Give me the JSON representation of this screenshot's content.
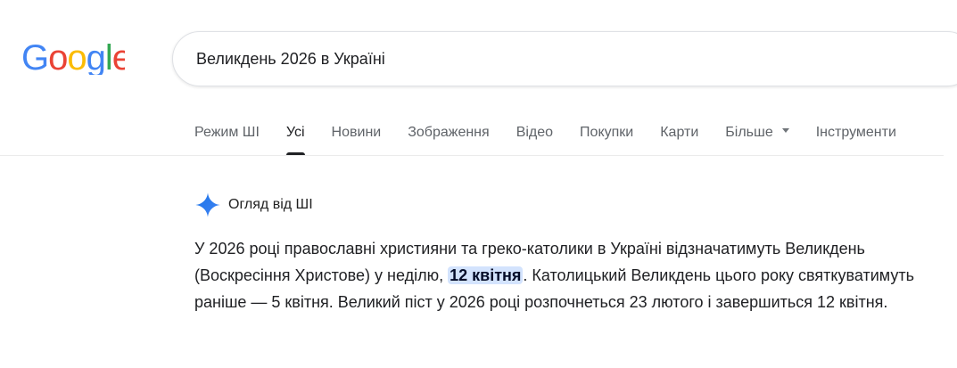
{
  "logo": {
    "text": "Google"
  },
  "search": {
    "query": "Великдень 2026 в Україні"
  },
  "tabs": [
    {
      "label": "Режим ШІ"
    },
    {
      "label": "Усі",
      "active": true
    },
    {
      "label": "Новини"
    },
    {
      "label": "Зображення"
    },
    {
      "label": "Відео"
    },
    {
      "label": "Покупки"
    },
    {
      "label": "Карти"
    },
    {
      "label": "Більше"
    },
    {
      "label": "Інструменти"
    }
  ],
  "ai_overview": {
    "title": "Огляд від ШІ",
    "text_part1": "У 2026 році православні християни та греко-католики в Україні відзначатимуть Великдень (Воскресіння Христове) у неділю, ",
    "highlight": "12 квітня",
    "text_part2": ". Католицький Великдень цього року святкуватимуть раніше — 5 квітня. Великий піст у 2026 році розпочнеться 23 лютого і завершиться 12 квітня."
  },
  "colors": {
    "google_blue": "#4285F4",
    "google_red": "#EA4335",
    "google_yellow": "#FBBC05",
    "google_green": "#34A853",
    "highlight_bg": "#d3e3fd"
  }
}
